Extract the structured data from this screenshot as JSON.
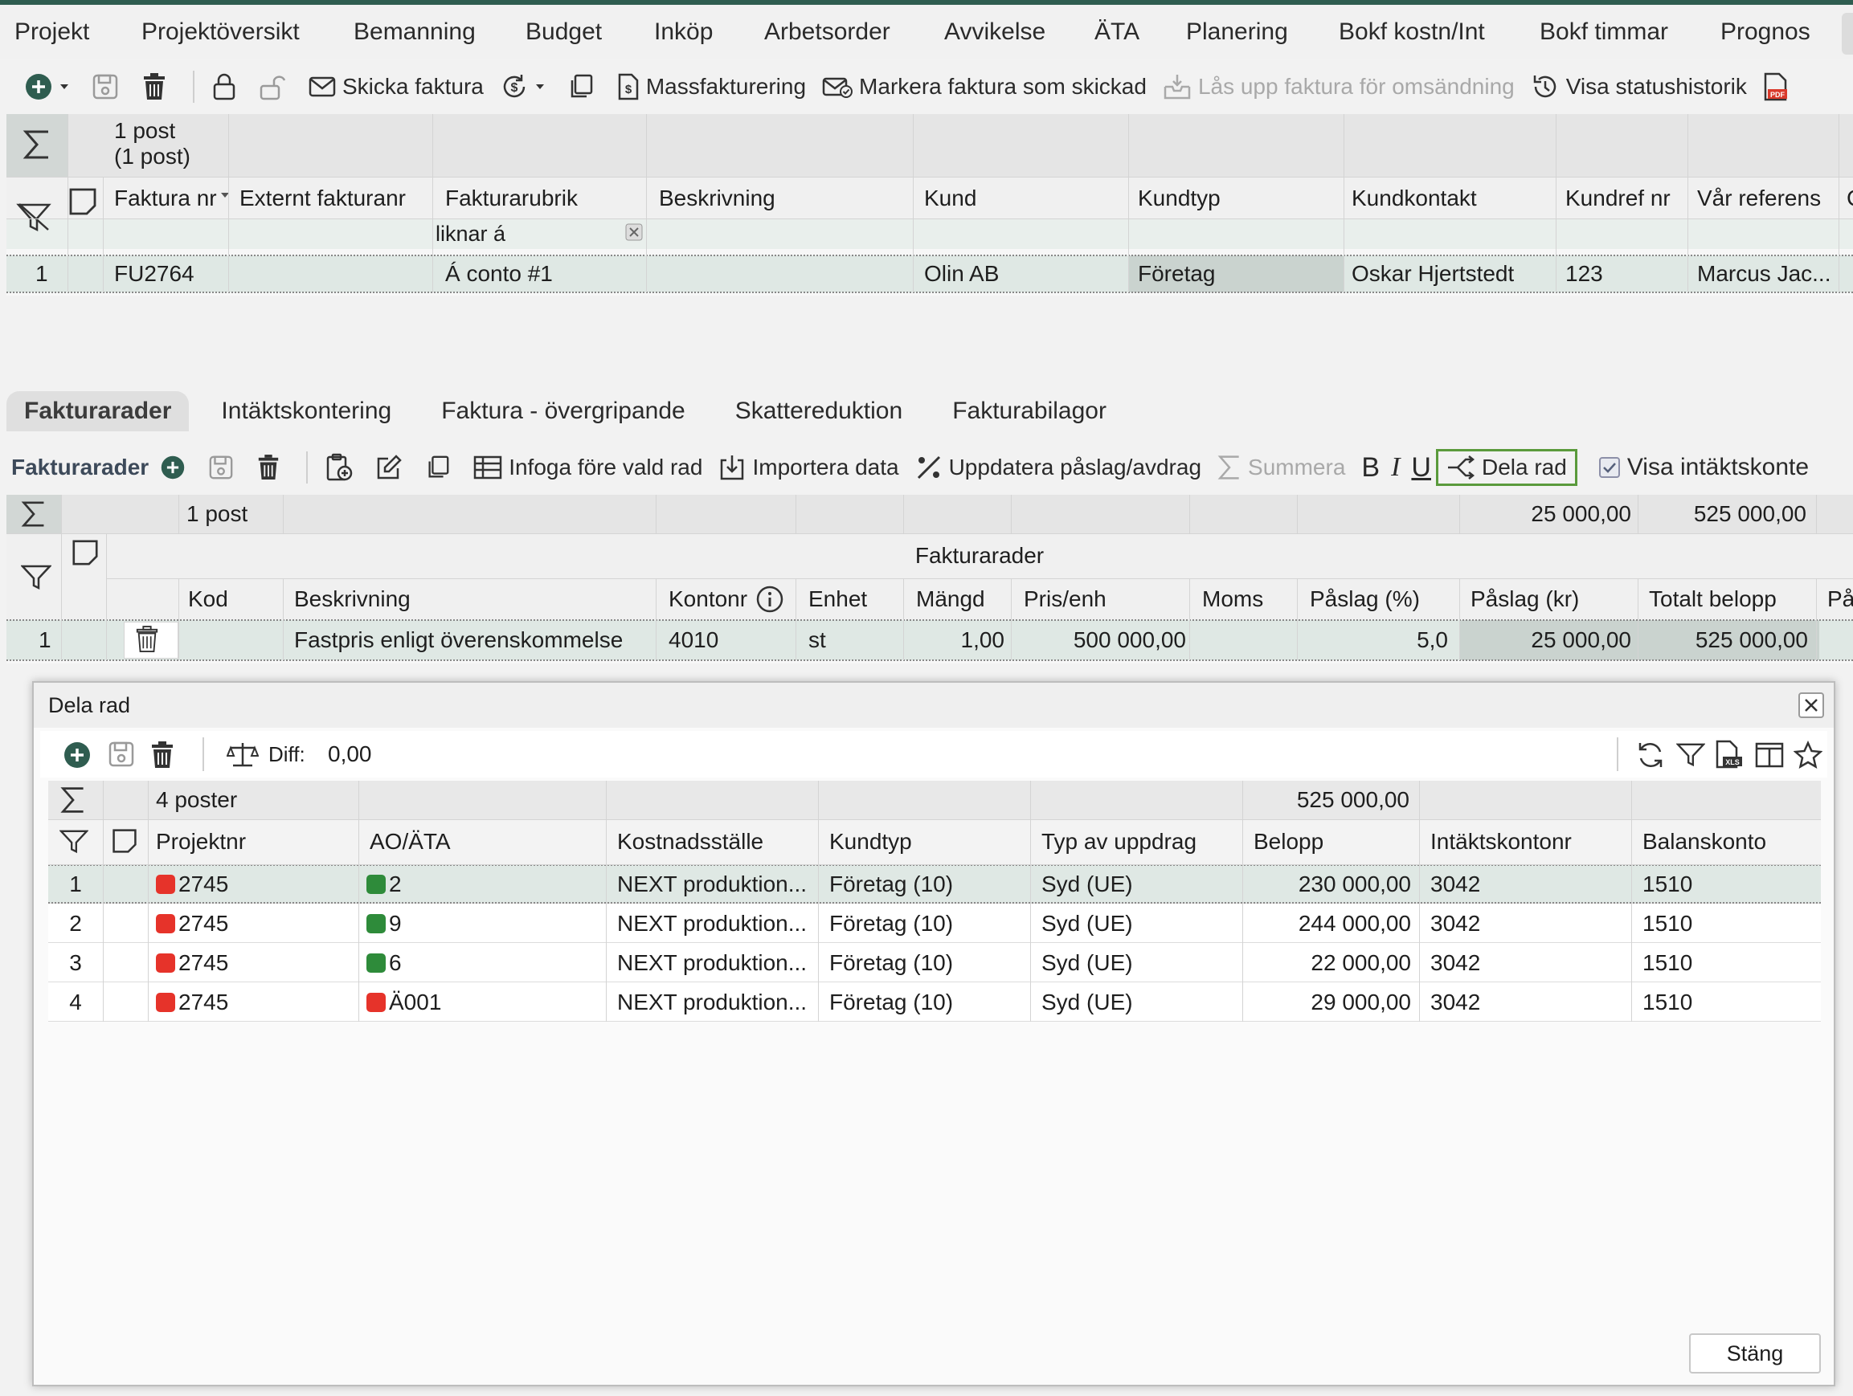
{
  "menu": [
    "Projekt",
    "Projektöversikt",
    "Bemanning",
    "Budget",
    "Inköp",
    "Arbetsorder",
    "Avvikelse",
    "ÄTA",
    "Planering",
    "Bokf kostn/Int",
    "Bokf timmar",
    "Prognos"
  ],
  "toolbar": {
    "send_invoice": "Skicka faktura",
    "mass_invoicing": "Massfakturering",
    "mark_sent": "Markera faktura som skickad",
    "unlock_resend": "Lås upp faktura för omsändning",
    "status_history": "Visa statushistorik"
  },
  "top_grid": {
    "summary": "1 post\n(1 post)",
    "summary_line1": "1 post",
    "summary_line2": "(1 post)",
    "headers": [
      "Faktura nr",
      "Externt fakturanr",
      "Fakturarubrik",
      "Beskrivning",
      "Kund",
      "Kundtyp",
      "Kundkontakt",
      "Kundref nr",
      "Vår referens"
    ],
    "filter_value": "liknar á",
    "row": {
      "num": "1",
      "faktura_nr": "FU2764",
      "externt": "",
      "rubrik": "Á conto #1",
      "beskrivning": "",
      "kund": "Olin AB",
      "kundtyp": "Företag",
      "kundkontakt": "Oskar Hjertstedt",
      "kundref": "123",
      "var_referens": "Marcus Jac..."
    }
  },
  "subtabs": [
    "Fakturarader",
    "Intäktskontering",
    "Faktura - övergripande",
    "Skattereduktion",
    "Fakturabilagor"
  ],
  "rows_toolbar": {
    "title": "Fakturarader",
    "insert_before": "Infoga före vald rad",
    "import": "Importera data",
    "update_markup": "Uppdatera påslag/avdrag",
    "sum": "Summera",
    "bold": "B",
    "italic": "I",
    "underline": "U",
    "split_row": "Dela rad",
    "show_revenue": "Visa intäktskonte"
  },
  "rows_grid": {
    "summary_count": "1 post",
    "sum_paslag_kr": "25 000,00",
    "sum_total": "525 000,00",
    "group_header": "Fakturarader",
    "headers": [
      "Kod",
      "Beskrivning",
      "Kontonr",
      "Enhet",
      "Mängd",
      "Pris/enh",
      "Moms",
      "Påslag (%)",
      "Påslag (kr)",
      "Totalt belopp",
      "På"
    ],
    "row": {
      "num": "1",
      "kod": "",
      "beskrivning": "Fastpris enligt överenskommelse",
      "kontonr": "4010",
      "enhet": "st",
      "mangd": "1,00",
      "pris": "500 000,00",
      "moms": "",
      "paslag_pct": "5,0",
      "paslag_kr": "25 000,00",
      "totalt": "525 000,00"
    }
  },
  "dialog": {
    "title": "Dela rad",
    "diff_label": "Diff:",
    "diff_value": "0,00",
    "summary_count": "4 poster",
    "summary_belopp": "525 000,00",
    "headers": [
      "Projektnr",
      "AO/ÄTA",
      "Kostnadsställe",
      "Kundtyp",
      "Typ av uppdrag",
      "Belopp",
      "Intäktskontonr",
      "Balanskonto"
    ],
    "rows": [
      {
        "num": "1",
        "projekt": "2745",
        "projekt_status": "red",
        "ao": "2",
        "ao_status": "green",
        "kst": "NEXT produktion...",
        "kundtyp": "Företag (10)",
        "typ": "Syd (UE)",
        "belopp": "230 000,00",
        "intakt": "3042",
        "balans": "1510"
      },
      {
        "num": "2",
        "projekt": "2745",
        "projekt_status": "red",
        "ao": "9",
        "ao_status": "green",
        "kst": "NEXT produktion...",
        "kundtyp": "Företag (10)",
        "typ": "Syd (UE)",
        "belopp": "244 000,00",
        "intakt": "3042",
        "balans": "1510"
      },
      {
        "num": "3",
        "projekt": "2745",
        "projekt_status": "red",
        "ao": "6",
        "ao_status": "green",
        "kst": "NEXT produktion...",
        "kundtyp": "Företag (10)",
        "typ": "Syd (UE)",
        "belopp": "22 000,00",
        "intakt": "3042",
        "balans": "1510"
      },
      {
        "num": "4",
        "projekt": "2745",
        "projekt_status": "red",
        "ao": "Ä001",
        "ao_status": "red",
        "kst": "NEXT produktion...",
        "kundtyp": "Företag (10)",
        "typ": "Syd (UE)",
        "belopp": "29 000,00",
        "intakt": "3042",
        "balans": "1510"
      }
    ],
    "close_label": "Stäng"
  },
  "colors": {
    "accent": "#2f5d50",
    "green": "#2e8b3a",
    "red": "#e6332a",
    "selected_row": "#dfe8e4",
    "highlight": "#5a9a3c"
  }
}
